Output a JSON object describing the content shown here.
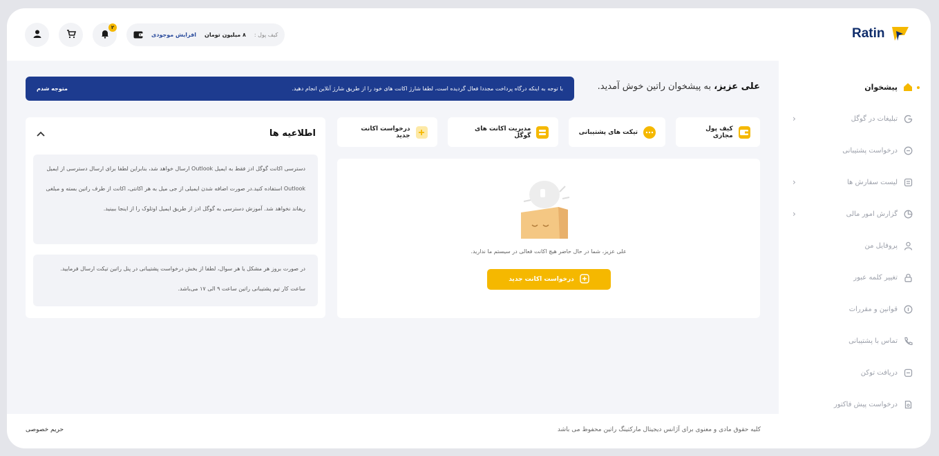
{
  "header": {
    "logo_text": "Ratin",
    "wallet_label": "کیف پول :",
    "wallet_value": "۸ میلیون تومان",
    "wallet_increase": "افزایش موجودی",
    "notification_count": "۲"
  },
  "sidebar": {
    "items": [
      {
        "label": "پیشخوان",
        "icon": "home-icon"
      },
      {
        "label": "تبلیغات در گوگل",
        "icon": "google-icon"
      },
      {
        "label": "درخواست پشتیبانی",
        "icon": "chat-icon"
      },
      {
        "label": "لیست سفارش ها",
        "icon": "list-icon"
      },
      {
        "label": "گزارش امور مالی",
        "icon": "pie-icon"
      },
      {
        "label": "پروفایل من",
        "icon": "user-icon"
      },
      {
        "label": "تغییر کلمه عبور",
        "icon": "lock-icon"
      },
      {
        "label": "قوانین و مقررات",
        "icon": "rules-icon"
      },
      {
        "label": "تماس با پشتیبانی",
        "icon": "phone-icon"
      },
      {
        "label": "دریافت توکن",
        "icon": "token-icon"
      },
      {
        "label": "درخواست پیش فاکتور",
        "icon": "invoice-icon"
      }
    ]
  },
  "welcome": {
    "name": "علی عزیز،",
    "text": " به پیشخوان راتین خوش آمدید."
  },
  "banner": {
    "text": "با توجه به اینکه درگاه پرداخت مجددا فعال گردیده است، لطفا شارژ اکانت های خود را از طریق شارژ آنلاین انجام دهید.",
    "ok_label": "متوجه شدم"
  },
  "quick_actions": [
    {
      "label": "کیف پول مجازی",
      "icon": "wallet-icon"
    },
    {
      "label": "تیکت های پشتیبانی",
      "icon": "ticket-icon"
    },
    {
      "label": "مدیریت اکانت های گوگل",
      "icon": "accounts-icon"
    },
    {
      "label": "درخواست اکانت جدید",
      "icon": "plus-icon"
    }
  ],
  "empty_state": {
    "text": "علی عزیز، شما در حال حاضر هیچ اکانت فعالی در سیستم ما ندارید.",
    "button": "درخواست اکانت جدید"
  },
  "notices": {
    "title": "اطلاعیه ها",
    "items": [
      "دسترسی اکانت گوگل ادز فقط به ایمیل Outlook ارسال خواهد شد، بنابراین لطفا برای ارسال دسترسی از ایمیل Outlook استفاده کنید.در صورت اضافه شدن ایمیلی از جی میل به هر اکانتی، اکانت از طرف راتین بسته و مبلغی ریفاند نخواهد شد. آموزش دسترسی به گوگل ادز از طریق ایمیل اوتلوک را از اینجا ببینید.",
      "در صورت بروز هر مشکل یا هر سوال، لطفا از بخش درخواست پشتیبانی در پنل راتین تیکت ارسال فرمایید. ساعت کار تیم پشتیبانی راتین ساعت ۹ الی ۱۷ می‌باشد."
    ]
  },
  "footer": {
    "copyright": "کلیه حقوق مادی و معنوی برای آژانس دیجیتال مارکتینگ راتین محفوظ می باشد",
    "privacy": "حریم خصوصی"
  },
  "colors": {
    "accent": "#f5b800",
    "brand": "#1d3b8f"
  }
}
